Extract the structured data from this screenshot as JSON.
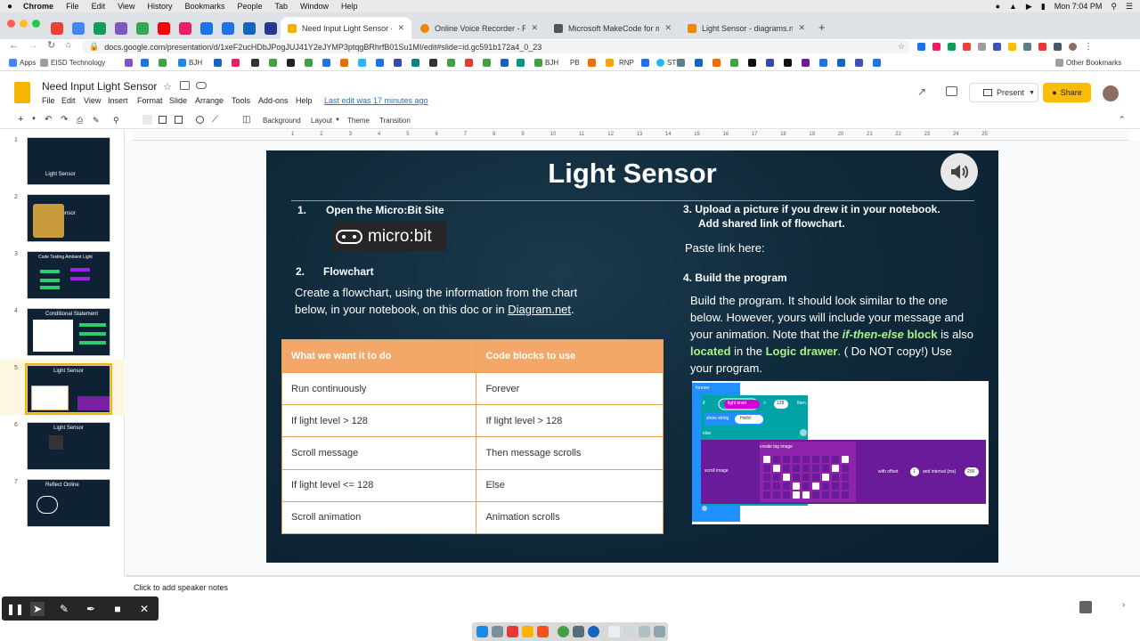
{
  "mac": {
    "apple": "",
    "app": "Chrome",
    "menus": [
      "File",
      "Edit",
      "View",
      "History",
      "Bookmarks",
      "People",
      "Tab",
      "Window",
      "Help"
    ],
    "clock": "Mon 7:04 PM"
  },
  "tabs": [
    {
      "title": "Need Input Light Sensor - Goo",
      "color": "#f4b400",
      "active": true
    },
    {
      "title": "Online Voice Recorder - Recor",
      "color": "#ea8600",
      "active": false
    },
    {
      "title": "Microsoft MakeCode for micro:",
      "color": "#555555",
      "active": false
    },
    {
      "title": "Light Sensor - diagrams.net",
      "color": "#f08705",
      "active": false
    }
  ],
  "address": {
    "url": "docs.google.com/presentation/d/1xeF2ucHDbJPogJUJ41Y2eJYMP3ptqgBRhrfB01Su1MI/edit#slide=id.gc591b172a4_0_23"
  },
  "bookmarks": {
    "apps": "Apps",
    "eisd": "EISD Technology",
    "bjh": "BJH",
    "bjh2": "BJH",
    "pb": "PB",
    "rnp": "RNP",
    "stu": "STU",
    "other": "Other Bookmarks"
  },
  "doc": {
    "title": "Need Input Light Sensor",
    "menus": [
      "File",
      "Edit",
      "View",
      "Insert",
      "Format",
      "Slide",
      "Arrange",
      "Tools",
      "Add-ons",
      "Help"
    ],
    "last_edit": "Last edit was 17 minutes ago",
    "present": "Present",
    "share": "Share"
  },
  "toolbar": {
    "background": "Background",
    "layout": "Layout",
    "theme": "Theme",
    "transition": "Transition"
  },
  "ruler": [
    "1",
    "2",
    "3",
    "4",
    "5",
    "6",
    "7",
    "8",
    "9",
    "10",
    "11",
    "12",
    "13",
    "14",
    "15",
    "16",
    "17",
    "18",
    "19",
    "20",
    "21",
    "22",
    "23",
    "24",
    "25"
  ],
  "filmstrip": [
    {
      "num": "1",
      "title": "Light Sensor"
    },
    {
      "num": "2",
      "title": "Light Sensor"
    },
    {
      "num": "3",
      "title": "Code Testing Ambient Light"
    },
    {
      "num": "4",
      "title": "Conditional Statement"
    },
    {
      "num": "5",
      "title": "Light Sensor"
    },
    {
      "num": "6",
      "title": "Light Sensor"
    },
    {
      "num": "7",
      "title": "Reflect Online"
    }
  ],
  "slide": {
    "title": "Light Sensor",
    "s1_num": "1.",
    "s1": "Open the Micro:Bit Site",
    "microbit": "micro:bit",
    "s2_num": "2.",
    "s2": "Flowchart",
    "s2_text": "Create a flowchart, using the information from the chart below, in your notebook, on this doc or in",
    "s2_link": "Diagram.net",
    "s2_end": ".",
    "s3a": "3. Upload a picture if you drew it in your notebook.",
    "s3b": "Add shared link of flowchart.",
    "paste": "Paste link here:",
    "s4": "4. Build the program",
    "s4_a": "Build the program. It should look similar to the one below. However, yours will include your message and your animation. Note that the",
    "s4_b": "if-then-else",
    "s4_c": "block",
    "s4_d": "is also",
    "s4_e": "located",
    "s4_f": "in the",
    "s4_g": "Logic drawer",
    "s4_h": ". ( Do NOT copy!) Use your program.",
    "table": {
      "headers": [
        "What we want it to do",
        "Code blocks to use"
      ],
      "rows": [
        [
          "Run continuously",
          "Forever"
        ],
        [
          "If light level > 128",
          "If light level > 128"
        ],
        [
          "Scroll message",
          "Then message scrolls"
        ],
        [
          "If light level <= 128",
          "Else"
        ],
        [
          "Scroll animation",
          "Animation scrolls"
        ]
      ]
    },
    "code": {
      "forever": "forever",
      "if": "if",
      "light": "light level",
      "gt": ">",
      "val": "128",
      "then": "then",
      "show": "show string",
      "hello": "Hello!",
      "else": "else",
      "scroll": "scroll image",
      "create": "create big image",
      "offset": "with offset",
      "off_val": "1",
      "interval": "and interval (ms)",
      "int_val": "200"
    }
  },
  "notes": "Click to add speaker notes"
}
